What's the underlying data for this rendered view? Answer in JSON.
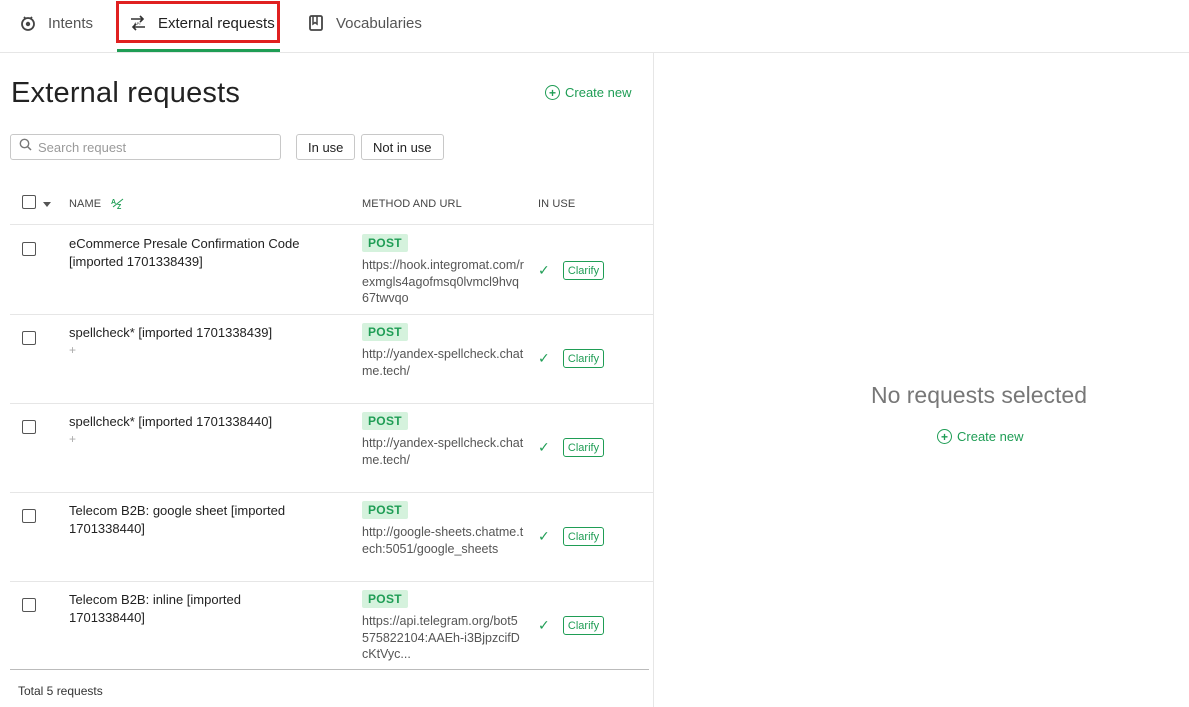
{
  "tabs": [
    {
      "label": "Intents",
      "icon": "intents-icon"
    },
    {
      "label": "External requests",
      "icon": "api-arrows-icon"
    },
    {
      "label": "Vocabularies",
      "icon": "book-icon"
    }
  ],
  "active_tab": "External requests",
  "page": {
    "title": "External requests",
    "create_new": "Create new"
  },
  "search": {
    "placeholder": "Search request",
    "value": ""
  },
  "filters": {
    "in_use": "In use",
    "not_in_use": "Not in use"
  },
  "table": {
    "headers": {
      "name": "NAME",
      "sort_icon_label": "AZ",
      "method_url": "METHOD AND URL",
      "in_use": "IN USE"
    },
    "rows": [
      {
        "name": "eCommerce Presale Confirmation Code [imported 1701338439]",
        "sub": "",
        "method": "POST",
        "url": "https://hook.integromat.com/rexmgls4agofmsq0lvmcl9hvq67twvqo",
        "in_use": true,
        "tag": "Clarify"
      },
      {
        "name": "spellcheck* [imported 1701338439]",
        "sub": "+",
        "method": "POST",
        "url": "http://yandex-spellcheck.chatme.tech/",
        "in_use": true,
        "tag": "Clarify"
      },
      {
        "name": "spellcheck* [imported 1701338440]",
        "sub": "+",
        "method": "POST",
        "url": "http://yandex-spellcheck.chatme.tech/",
        "in_use": true,
        "tag": "Clarify"
      },
      {
        "name": "Telecom B2B: google sheet [imported 1701338440]",
        "sub": "",
        "method": "POST",
        "url": "http://google-sheets.chatme.tech:5051/google_sheets",
        "in_use": true,
        "tag": "Clarify"
      },
      {
        "name": "Telecom B2B: inline [imported 1701338440]",
        "sub": "",
        "method": "POST",
        "url": "https://api.telegram.org/bot5575822104:AAEh-i3BjpzcifDcKtVyc...",
        "in_use": true,
        "tag": "Clarify"
      }
    ],
    "total": "Total 5 requests"
  },
  "right_panel": {
    "empty_message": "No requests selected",
    "create_new": "Create new"
  },
  "colors": {
    "accent": "#1f9d55",
    "highlight": "#e02020",
    "badge_bg": "#d5f2dd"
  }
}
